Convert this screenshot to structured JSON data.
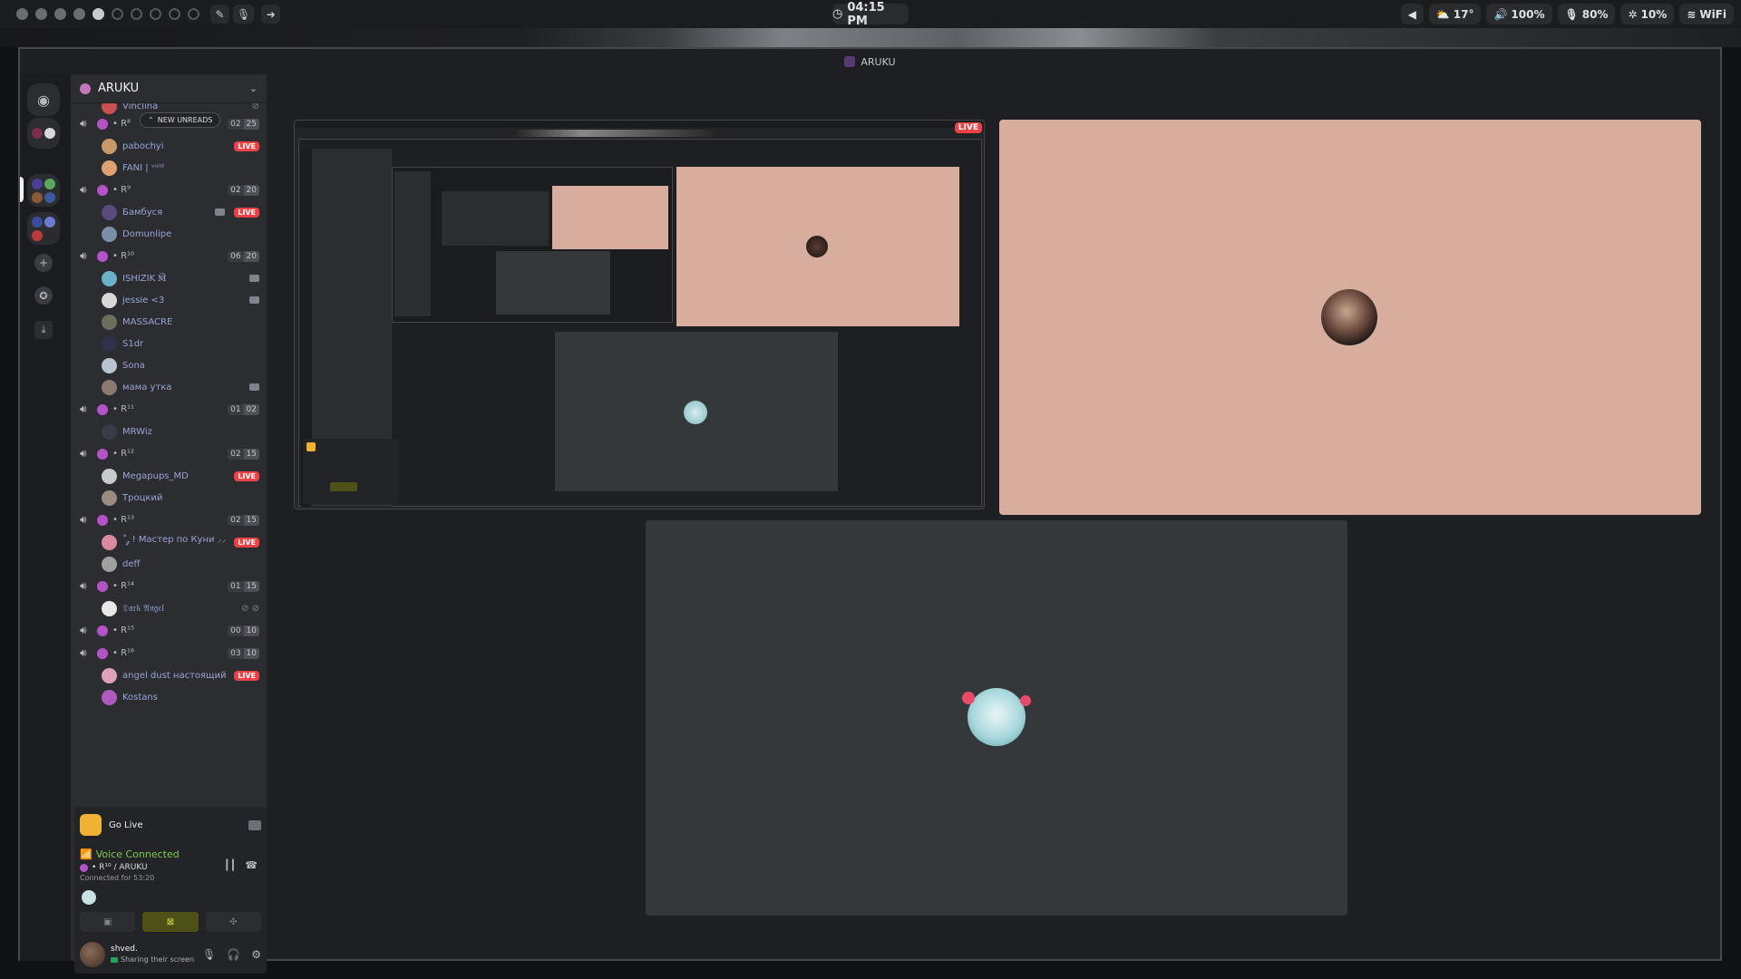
{
  "topbar": {
    "clock": "04:15 PM",
    "tray": {
      "weather": "17°",
      "volume": "100%",
      "mic": "80%",
      "cpu": "10%",
      "wifi": "WiFi"
    }
  },
  "window": {
    "title": "ARUKU"
  },
  "guild": {
    "name": "ARUKU",
    "new_unreads": "NEW UNREADS",
    "top_user": "Vinclina"
  },
  "channels": [
    {
      "name": "• R⁸",
      "count": "02",
      "limit": "25",
      "users": [
        {
          "name": "pabochyi",
          "live": "LIVE",
          "color": "#c89a6a"
        },
        {
          "name": "FANI | ᵛᵒⁱᵈ",
          "color": "#e0a070"
        }
      ]
    },
    {
      "name": "• R⁹",
      "count": "02",
      "limit": "20",
      "users": [
        {
          "name": "Бамбуся",
          "cam": true,
          "live": "LIVE",
          "color": "#5b4a7d"
        },
        {
          "name": "Domunlipe",
          "color": "#7a8fa8"
        }
      ]
    },
    {
      "name": "• R¹⁰",
      "count": "06",
      "limit": "20",
      "users": [
        {
          "name": "ISHIZIK 🕅",
          "cam": true,
          "color": "#6ab0c8"
        },
        {
          "name": "jessie <3",
          "cam": true,
          "color": "#d8d8d8"
        },
        {
          "name": "MASSACRE",
          "color": "#6b6e5a"
        },
        {
          "name": "S1dr",
          "color": "#30304a"
        },
        {
          "name": "Sona",
          "color": "#b8c4d0"
        },
        {
          "name": "мама утка",
          "cam": true,
          "color": "#8a7a70"
        }
      ]
    },
    {
      "name": "• R¹¹",
      "count": "01",
      "limit": "02",
      "users": [
        {
          "name": "MRWiz",
          "color": "#3a3c48"
        }
      ]
    },
    {
      "name": "• R¹²",
      "count": "02",
      "limit": "15",
      "users": [
        {
          "name": "Megapups_MD",
          "live": "LIVE",
          "color": "#c7c9cc"
        },
        {
          "name": "Троцкий",
          "color": "#9a8a80"
        }
      ]
    },
    {
      "name": "• R¹³",
      "count": "02",
      "limit": "15",
      "users": [
        {
          "name": "˚.༘ ! Мастер по Куни ⸝⸝",
          "live": "LIVE",
          "color": "#d88aa0"
        },
        {
          "name": "deff",
          "color": "#a0a0a0"
        }
      ]
    },
    {
      "name": "• R¹⁴",
      "count": "01",
      "limit": "15",
      "users": [
        {
          "name": "𝔇𝔞𝔯𝔨 𝔄𝔫𝔤𝔢𝔩",
          "status_icons": true,
          "color": "#e8e8e8"
        }
      ]
    },
    {
      "name": "• R¹⁵",
      "count": "00",
      "limit": "10",
      "users": []
    },
    {
      "name": "• R¹⁶",
      "count": "03",
      "limit": "10",
      "users": [
        {
          "name": "angel dust настоящий",
          "live": "LIVE",
          "color": "#e0a0b8"
        },
        {
          "name": "Kostans",
          "color": "#b05ac0"
        }
      ]
    }
  ],
  "golive": {
    "label": "Go Live"
  },
  "voice": {
    "title": "Voice Connected",
    "channel": "• R¹⁰ / ARUKU",
    "connected_for": "Connected for 53:20"
  },
  "user": {
    "name": "shved.",
    "status": "Sharing their screen"
  },
  "stage": {
    "live_label": "LIVE"
  },
  "colors": {
    "accent_live": "#ed4245",
    "voice_green": "#80c74a",
    "tile_pink": "#d7ad9d",
    "tile_dark": "#35383a",
    "channel_dot": "#b452c8"
  }
}
